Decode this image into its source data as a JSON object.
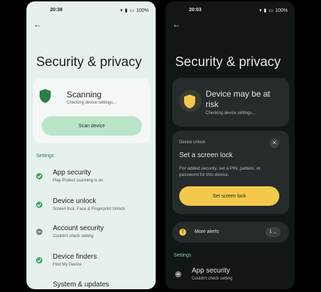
{
  "light": {
    "status": {
      "time": "20:38",
      "battery": "100%"
    },
    "title": "Security & privacy",
    "status_card": {
      "title": "Scanning",
      "subtitle": "Checking device settings...",
      "button": "Scan device"
    },
    "section": "Settings",
    "items": [
      {
        "title": "App security",
        "subtitle": "Play Protect scanning is on",
        "state": "ok"
      },
      {
        "title": "Device unlock",
        "subtitle": "Screen lock, Face & Fingerprint Unlock",
        "state": "ok"
      },
      {
        "title": "Account security",
        "subtitle": "Couldn't check setting",
        "state": "warn"
      },
      {
        "title": "Device finders",
        "subtitle": "Find My Device",
        "state": "ok"
      },
      {
        "title": "System & updates",
        "subtitle": "",
        "state": "ok"
      }
    ]
  },
  "dark": {
    "status": {
      "time": "20:03",
      "battery": "100%"
    },
    "title": "Security & privacy",
    "status_card": {
      "title": "Device may be at risk",
      "subtitle": "Checking device settings..."
    },
    "lock_card": {
      "tag": "Device unlock",
      "title": "Set a screen lock",
      "body": "For added security, set a PIN, pattern, or password for this device.",
      "button": "Set screen lock"
    },
    "alerts": {
      "label": "More alerts",
      "count": "1"
    },
    "section": "Settings",
    "items": [
      {
        "title": "App security",
        "subtitle": "Couldn't check setting",
        "state": "warn"
      }
    ]
  },
  "colors": {
    "accent_green": "#3aa35b",
    "warning_yellow": "#f2c94c"
  }
}
